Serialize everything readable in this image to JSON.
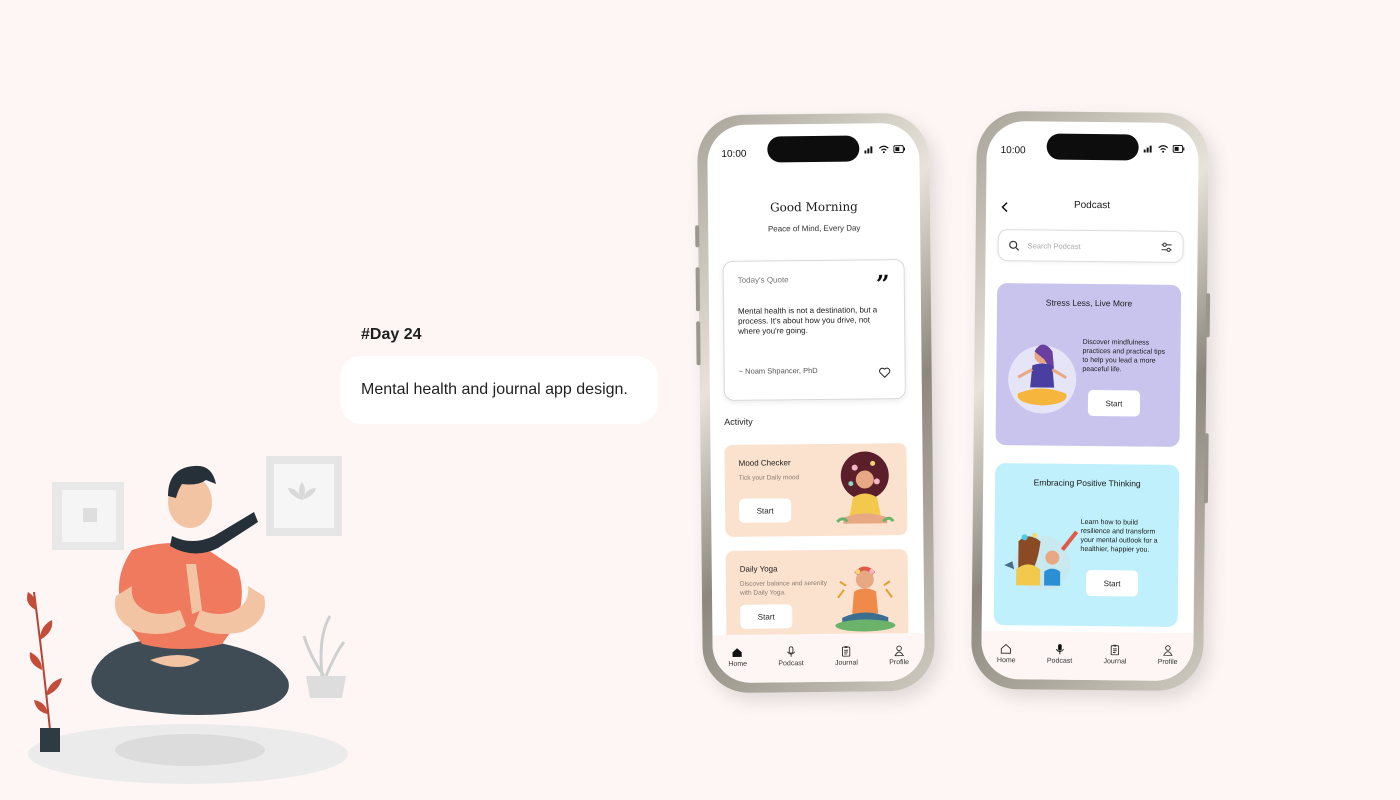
{
  "slide": {
    "day_tag": "#Day 24",
    "description": "Mental health and journal app design."
  },
  "status_bar": {
    "time": "10:00"
  },
  "home_screen": {
    "greeting": "Good Morning",
    "tagline": "Peace of Mind, Every Day",
    "quote": {
      "label": "Today's Quote",
      "mark": "”",
      "text": "Mental health is not a destination, but a process. It's about how you drive, not where you're going.",
      "author": "~ Noam Shpancer, PhD"
    },
    "activity_label": "Activity",
    "activities": [
      {
        "title": "Mood Checker",
        "subtitle": "Tick your Daily mood",
        "button": "Start"
      },
      {
        "title": "Daily Yoga",
        "subtitle": "Discover balance and serenity with Daily Yoga.",
        "button": "Start"
      }
    ]
  },
  "podcast_screen": {
    "title": "Podcast",
    "search_placeholder": "Search Podcast",
    "cards": [
      {
        "title": "Stress Less, Live More",
        "description": "Discover mindfulness practices and practical tips to help you lead a more peaceful life.",
        "button": "Start"
      },
      {
        "title": "Embracing Positive Thinking",
        "description": "Learn how to build resilience and transform your mental outlook for a healthier, happier you.",
        "button": "Start"
      }
    ]
  },
  "nav": [
    {
      "label": "Home",
      "icon": "home-icon"
    },
    {
      "label": "Podcast",
      "icon": "microphone-icon"
    },
    {
      "label": "Journal",
      "icon": "clipboard-icon"
    },
    {
      "label": "Profile",
      "icon": "user-icon"
    }
  ],
  "colors": {
    "background": "#fdf6f5",
    "activity_card": "#fbe2cf",
    "podcast_card_1": "#c8c4ee",
    "podcast_card_2": "#bff0fb",
    "shirt": "#ef7a5d"
  }
}
